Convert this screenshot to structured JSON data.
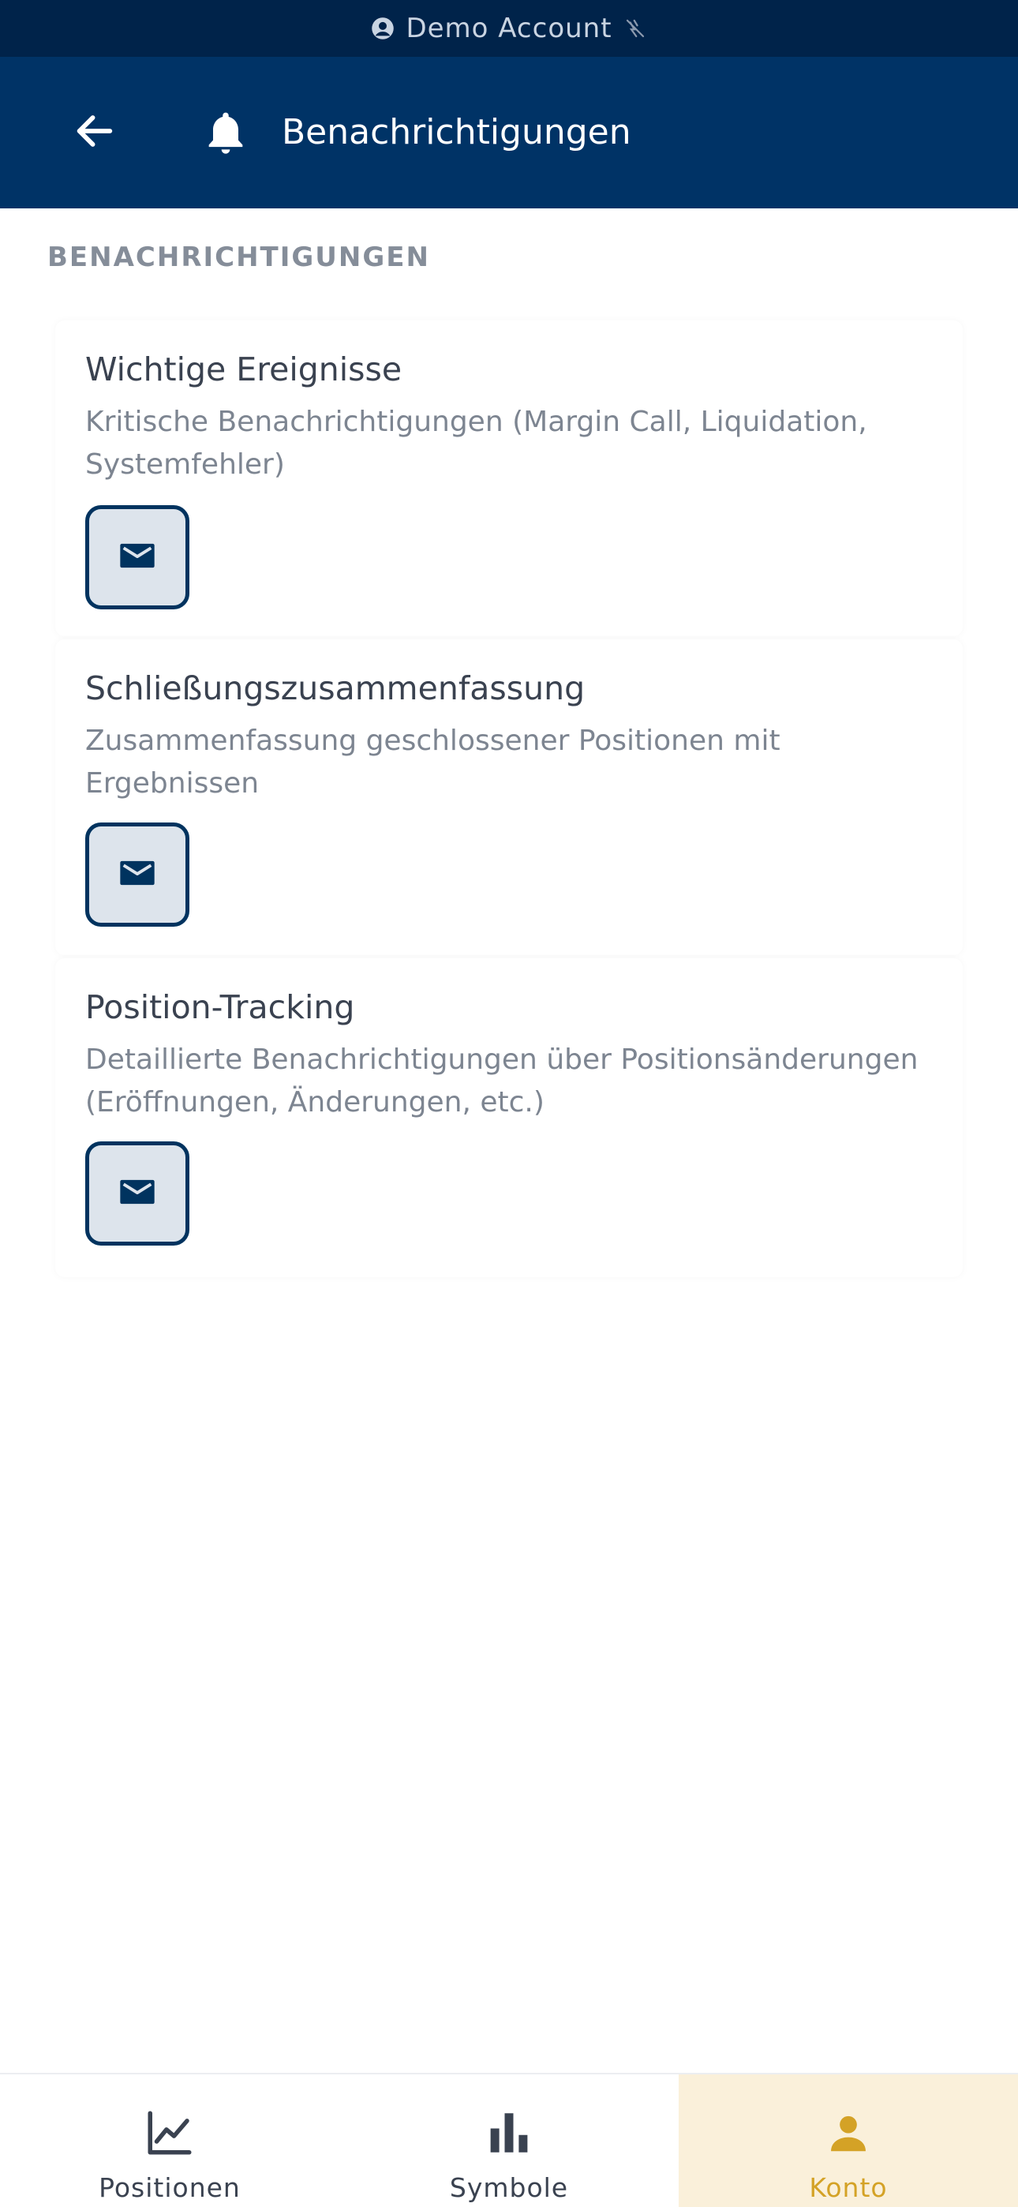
{
  "status_bar": {
    "account_label": "Demo Account",
    "account_icon": "account-circle-icon",
    "connection_icon": "cloud-off-icon"
  },
  "header": {
    "back_icon": "arrow-left-icon",
    "title_icon": "bell-icon",
    "title": "Benachrichtigungen"
  },
  "section": {
    "label": "BENACHRICHTIGUNGEN"
  },
  "notifications": [
    {
      "title": "Wichtige Ereignisse",
      "description": "Kritische Benachrichtigungen (Margin Call, Liquidation, Systemfehler)",
      "channel_icon": "email-icon"
    },
    {
      "title": "Schließungszusammenfassung",
      "description": "Zusammenfassung geschlossener Positionen mit Ergebnissen",
      "channel_icon": "email-icon"
    },
    {
      "title": "Position-Tracking",
      "description": "Detaillierte Benachrichtigungen über Positionsänderungen (Eröffnungen, Änderungen, etc.)",
      "channel_icon": "email-icon"
    }
  ],
  "bottom_nav": {
    "items": [
      {
        "label": "Positionen",
        "icon": "line-chart-icon",
        "active": false
      },
      {
        "label": "Symbole",
        "icon": "bar-chart-icon",
        "active": false
      },
      {
        "label": "Konto",
        "icon": "person-icon",
        "active": true
      }
    ]
  },
  "colors": {
    "status_strip": "#00234a",
    "header": "#003366",
    "accent": "#d4a226",
    "active_tab_bg": "#faf0da",
    "toggle_border": "#00335f",
    "toggle_bg": "#dde4ec"
  }
}
